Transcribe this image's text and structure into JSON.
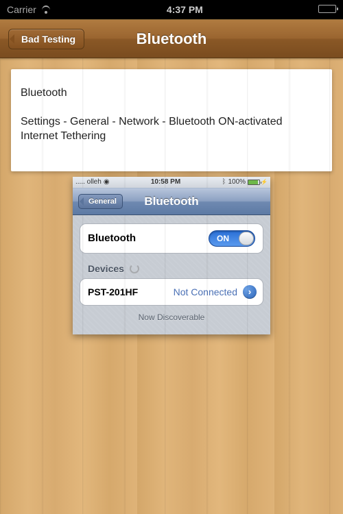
{
  "outer_status": {
    "carrier": "Carrier",
    "time": "4:37 PM"
  },
  "app_nav": {
    "back_label": "Bad Testing",
    "title": "Bluetooth"
  },
  "card": {
    "heading": "Bluetooth",
    "body": "Settings - General - Network - Bluetooth ON-activated Internet Tethering"
  },
  "inner_status": {
    "carrier": "..... olleh",
    "time": "10:58 PM",
    "battery_pct": "100%"
  },
  "inner_nav": {
    "back_label": "General",
    "title": "Bluetooth"
  },
  "bluetooth": {
    "row_label": "Bluetooth",
    "toggle_label": "ON",
    "devices_header": "Devices",
    "device": {
      "name": "PST-201HF",
      "status": "Not Connected"
    },
    "footer": "Now Discoverable"
  }
}
